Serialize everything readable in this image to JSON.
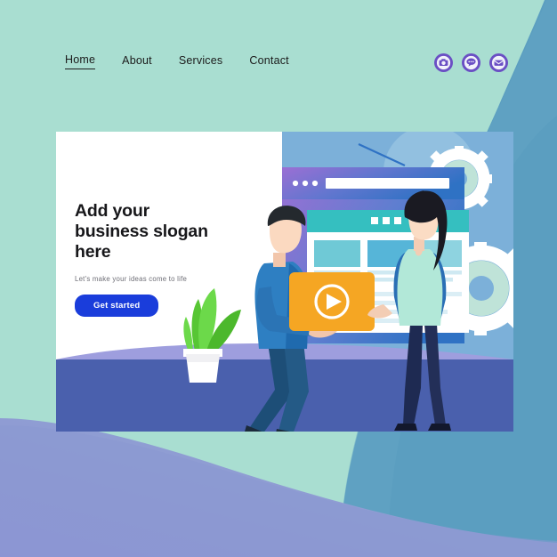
{
  "page": {
    "bg_color": "#a9ded1",
    "bottom_left_gradient": [
      "#9a9ed8",
      "#7e9ccd"
    ],
    "bottom_right_color": "#5b9ec0",
    "card_bg": "#ffffff"
  },
  "nav": {
    "items": [
      {
        "label": "Home",
        "active": true
      },
      {
        "label": "About",
        "active": false
      },
      {
        "label": "Services",
        "active": false
      },
      {
        "label": "Contact",
        "active": false
      }
    ]
  },
  "social": {
    "icons": [
      {
        "name": "camera-icon",
        "color": "#6a4fc4"
      },
      {
        "name": "chat-bubble-icon",
        "color": "#6a4fc4"
      },
      {
        "name": "envelope-icon",
        "color": "#6a4fc4"
      }
    ]
  },
  "hero": {
    "headline_line1": "Add your",
    "headline_line2": "business slogan",
    "headline_line3": "here",
    "subtitle": "Let's make your ideas come to life",
    "cta_label": "Get started",
    "cta_color": "#1a3ddb"
  },
  "illustration": {
    "browser_window": {
      "header_gradient": [
        "#9b6fd4",
        "#2f72c4"
      ],
      "dots": 3,
      "address_bar_color": "#ffffff"
    },
    "inner_window": {
      "header_color": "#35bfc0",
      "dots": 3,
      "body_color": "#ffffff"
    },
    "video_card": {
      "color": "#f5a623",
      "icon": "play-icon"
    },
    "gears": {
      "count": 2,
      "color": "#ffffff",
      "inner_color": "#bfe3d8"
    },
    "plant": {
      "leaf_color": "#57c634",
      "pot_color": "#ffffff"
    },
    "floor_color": "#4a60ad",
    "floor_arc_color": "#9e9ede",
    "person_left": {
      "name": "man-carrying-card",
      "shirt_color": "#2e7fc2",
      "pants_color": "#1d4e77",
      "hair_color": "#24292e"
    },
    "person_right": {
      "name": "woman-standing",
      "top_color": "#b2e8d8",
      "sleeve_color": "#2a6fb5",
      "pants_color": "#1e2a52",
      "hair_color": "#1a1a22"
    }
  }
}
